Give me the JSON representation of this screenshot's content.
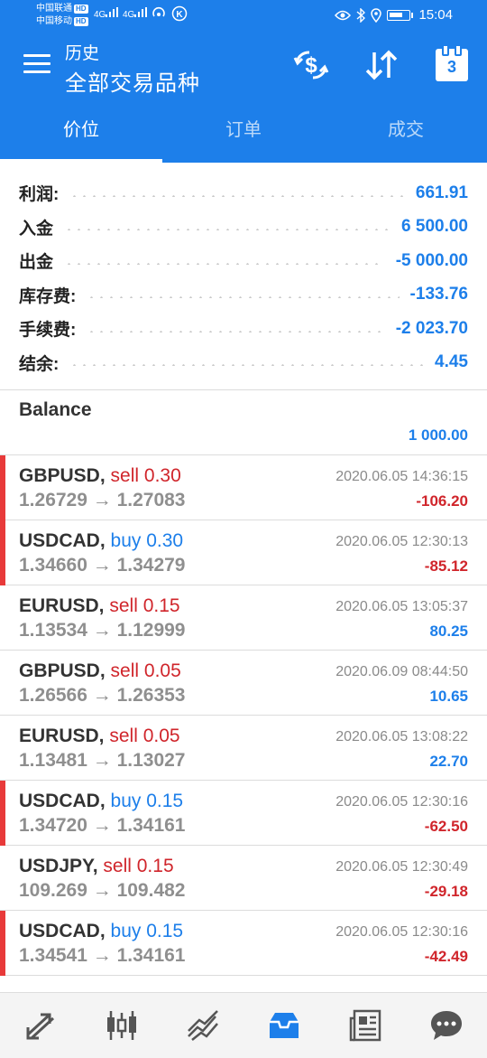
{
  "status_bar": {
    "carrier1": "中国联通",
    "carrier2": "中国移动",
    "hd": "HD",
    "signal1": "4G",
    "signal2": "4G",
    "time": "15:04"
  },
  "header": {
    "subtitle": "历史",
    "title": "全部交易品种",
    "calendar_day": "3",
    "colors": {
      "primary": "#1d7fea"
    }
  },
  "tabs": [
    {
      "label": "价位",
      "active": true
    },
    {
      "label": "订单",
      "active": false
    },
    {
      "label": "成交",
      "active": false
    }
  ],
  "summary": [
    {
      "label": "利润:",
      "value": "661.91"
    },
    {
      "label": "入金",
      "value": "6 500.00"
    },
    {
      "label": "出金",
      "value": "-5 000.00"
    },
    {
      "label": "库存费:",
      "value": "-133.76"
    },
    {
      "label": "手续费:",
      "value": "-2 023.70"
    },
    {
      "label": "结余:",
      "value": "4.45"
    }
  ],
  "balance": {
    "title": "Balance",
    "value": "1 000.00"
  },
  "trades": [
    {
      "symbol": "GBPUSD,",
      "side": "sell",
      "volume": "0.30",
      "prices": "1.26729 → 1.27083",
      "time": "2020.06.05 14:36:15",
      "profit": "-106.20",
      "loss": true
    },
    {
      "symbol": "USDCAD,",
      "side": "buy",
      "volume": "0.30",
      "prices": "1.34660 → 1.34279",
      "time": "2020.06.05 12:30:13",
      "profit": "-85.12",
      "loss": true
    },
    {
      "symbol": "EURUSD,",
      "side": "sell",
      "volume": "0.15",
      "prices": "1.13534 → 1.12999",
      "time": "2020.06.05 13:05:37",
      "profit": "80.25",
      "loss": false
    },
    {
      "symbol": "GBPUSD,",
      "side": "sell",
      "volume": "0.05",
      "prices": "1.26566 → 1.26353",
      "time": "2020.06.09 08:44:50",
      "profit": "10.65",
      "loss": false
    },
    {
      "symbol": "EURUSD,",
      "side": "sell",
      "volume": "0.05",
      "prices": "1.13481 → 1.13027",
      "time": "2020.06.05 13:08:22",
      "profit": "22.70",
      "loss": false
    },
    {
      "symbol": "USDCAD,",
      "side": "buy",
      "volume": "0.15",
      "prices": "1.34720 → 1.34161",
      "time": "2020.06.05 12:30:16",
      "profit": "-62.50",
      "loss": true
    },
    {
      "symbol": "USDJPY,",
      "side": "sell",
      "volume": "0.15",
      "prices": "109.269 → 109.482",
      "time": "2020.06.05 12:30:49",
      "profit": "-29.18",
      "loss": true
    },
    {
      "symbol": "USDCAD,",
      "side": "buy",
      "volume": "0.15",
      "prices": "1.34541 → 1.34161",
      "time": "2020.06.05 12:30:16",
      "profit": "-42.49",
      "loss": true
    }
  ],
  "bottom_nav": [
    {
      "icon": "quotes-icon",
      "active": false
    },
    {
      "icon": "chart-candles-icon",
      "active": false
    },
    {
      "icon": "trade-icon",
      "active": false
    },
    {
      "icon": "history-inbox-icon",
      "active": true
    },
    {
      "icon": "news-icon",
      "active": false
    },
    {
      "icon": "chat-icon",
      "active": false
    }
  ]
}
